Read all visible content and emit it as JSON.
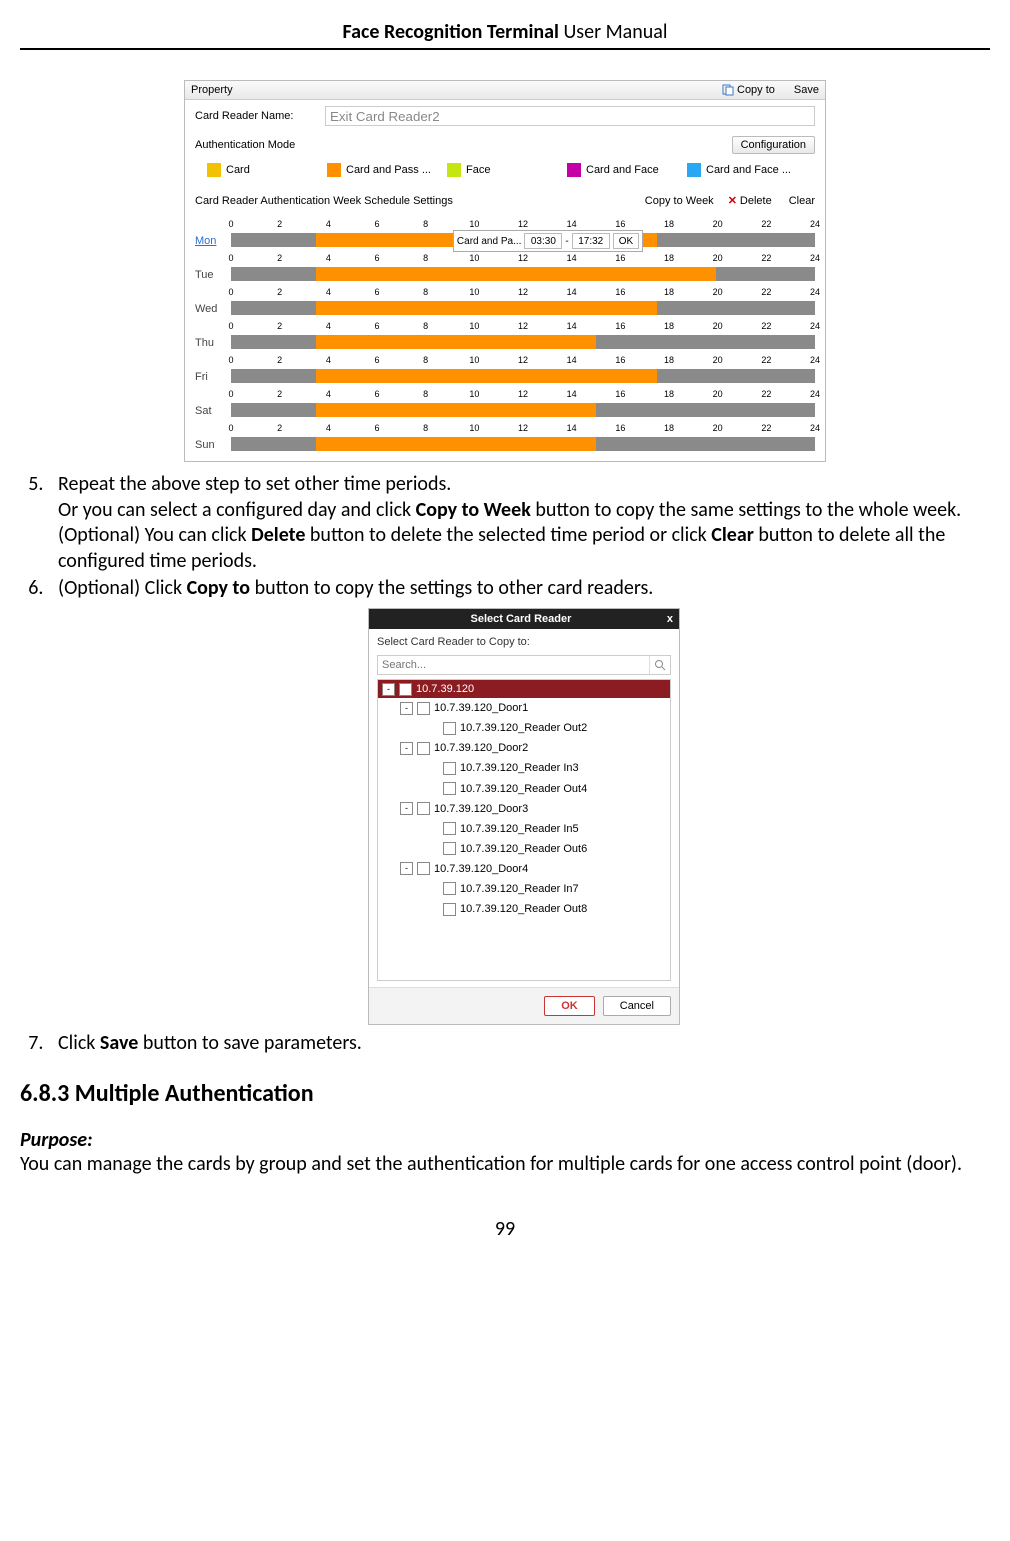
{
  "header": {
    "bold": "Face Recognition Terminal",
    "rest": "  User Manual"
  },
  "page_number": "99",
  "shot1": {
    "property_label": "Property",
    "copy_to_label": "Copy to",
    "save_label": "Save",
    "name_label": "Card Reader Name:",
    "name_value": "Exit Card Reader2",
    "auth_mode_label": "Authentication Mode",
    "config_btn": "Configuration",
    "legend": [
      {
        "cls": "c1",
        "text": "Card"
      },
      {
        "cls": "c2",
        "text": "Card and Pass ..."
      },
      {
        "cls": "c3",
        "text": "Face"
      },
      {
        "cls": "c4",
        "text": "Card and Face"
      },
      {
        "cls": "c5",
        "text": "Card and Face ..."
      }
    ],
    "sched_title": "Card Reader Authentication Week Schedule Settings",
    "copy_week": "Copy to Week",
    "delete": "Delete",
    "clear": "Clear",
    "hours": [
      "0",
      "2",
      "4",
      "6",
      "8",
      "10",
      "12",
      "14",
      "16",
      "18",
      "20",
      "22",
      "24"
    ],
    "popup_label": "Card and Pa...",
    "popup_start": "03:30",
    "popup_end": "17:32",
    "popup_ok": "OK",
    "days": [
      {
        "name": "Mon",
        "active": true,
        "seg_start": 14.5,
        "seg_end": 73.0,
        "popup": true
      },
      {
        "name": "Tue",
        "active": false,
        "seg_start": 14.5,
        "seg_end": 83.0
      },
      {
        "name": "Wed",
        "active": false,
        "seg_start": 14.5,
        "seg_end": 73.0
      },
      {
        "name": "Thu",
        "active": false,
        "seg_start": 14.5,
        "seg_end": 62.5
      },
      {
        "name": "Fri",
        "active": false,
        "seg_start": 14.5,
        "seg_end": 73.0
      },
      {
        "name": "Sat",
        "active": false,
        "seg_start": 14.5,
        "seg_end": 62.5
      },
      {
        "name": "Sun",
        "active": false,
        "seg_start": 14.5,
        "seg_end": 62.5
      }
    ]
  },
  "steps": {
    "s5_a": "Repeat the above step to set other time periods.",
    "s5_b_pre": "Or you can select a configured day and click ",
    "s5_b_bold": "Copy to Week",
    "s5_b_post": " button to copy the same settings to the whole week.",
    "s5_c_pre": "(Optional) You can click ",
    "s5_c_b1": "Delete",
    "s5_c_mid": " button to delete the selected time period or click ",
    "s5_c_b2": "Clear",
    "s5_c_post": " button to delete all the configured time periods.",
    "s6_pre": "(Optional) Click ",
    "s6_b": "Copy to",
    "s6_post": " button to copy the settings to other card readers.",
    "s7_pre": "Click ",
    "s7_b": "Save",
    "s7_post": " button to save parameters."
  },
  "shot2": {
    "title": "Select Card Reader",
    "sub": "Select Card Reader to Copy to:",
    "search_ph": "Search...",
    "root": "10.7.39.120",
    "nodes": [
      {
        "lvl": 1,
        "tog": "-",
        "text": "10.7.39.120_Door1"
      },
      {
        "lvl": 2,
        "tog": "",
        "text": "10.7.39.120_Reader Out2"
      },
      {
        "lvl": 1,
        "tog": "-",
        "text": "10.7.39.120_Door2"
      },
      {
        "lvl": 2,
        "tog": "",
        "text": "10.7.39.120_Reader In3"
      },
      {
        "lvl": 2,
        "tog": "",
        "text": "10.7.39.120_Reader Out4"
      },
      {
        "lvl": 1,
        "tog": "-",
        "text": "10.7.39.120_Door3"
      },
      {
        "lvl": 2,
        "tog": "",
        "text": "10.7.39.120_Reader In5"
      },
      {
        "lvl": 2,
        "tog": "",
        "text": "10.7.39.120_Reader Out6"
      },
      {
        "lvl": 1,
        "tog": "-",
        "text": "10.7.39.120_Door4"
      },
      {
        "lvl": 2,
        "tog": "",
        "text": "10.7.39.120_Reader In7"
      },
      {
        "lvl": 2,
        "tog": "",
        "text": "10.7.39.120_Reader Out8"
      }
    ],
    "ok": "OK",
    "cancel": "Cancel"
  },
  "section": {
    "num_title": "6.8.3   Multiple Authentication",
    "purpose": "Purpose:",
    "purpose_text": "You can manage the cards by group and set the authentication for multiple cards for one access control point (door)."
  }
}
